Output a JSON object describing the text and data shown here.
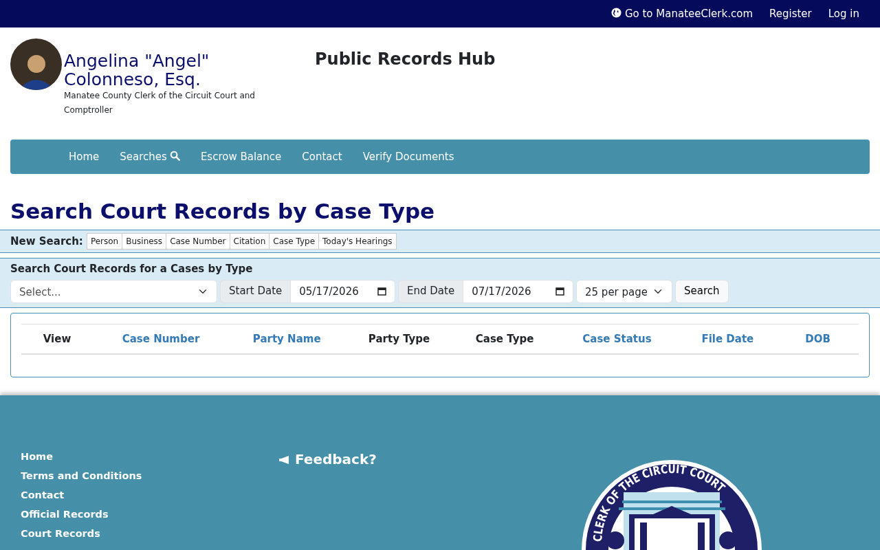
{
  "top_bar": {
    "links": [
      {
        "label": "Go to ManateeClerk.com"
      },
      {
        "label": "Register"
      },
      {
        "label": "Log in"
      }
    ]
  },
  "header": {
    "name_lines": [
      "Angelina \"Angel\"",
      "Colonneso, Esq."
    ],
    "subtitle": "Manatee County Clerk of the Circuit Court and Comptroller",
    "site_title": "Public Records Hub"
  },
  "nav": [
    {
      "label": "Home"
    },
    {
      "label": "Searches"
    },
    {
      "label": "Escrow Balance"
    },
    {
      "label": "Contact"
    },
    {
      "label": "Verify Documents"
    }
  ],
  "page_title": "Search Court Records by Case Type",
  "new_search": {
    "label": "New Search:",
    "options": [
      {
        "label": "Person"
      },
      {
        "label": "Business"
      },
      {
        "label": "Case Number"
      },
      {
        "label": "Citation"
      },
      {
        "label": "Case Type"
      },
      {
        "label": "Today's Hearings"
      }
    ]
  },
  "search_form": {
    "title": "Search Court Records for a Cases by Type",
    "case_type": {
      "value": "Select..."
    },
    "start_date": {
      "label": "Start Date",
      "value": "05/17/2026"
    },
    "end_date": {
      "label": "End Date",
      "value": "07/17/2026"
    },
    "per_page": {
      "value": "25 per page"
    },
    "button": "Search"
  },
  "table": {
    "columns": [
      {
        "label": "View",
        "sortable": false
      },
      {
        "label": "Case Number",
        "sortable": true
      },
      {
        "label": "Party Name",
        "sortable": true
      },
      {
        "label": "Party Type",
        "sortable": false
      },
      {
        "label": "Case Type",
        "sortable": false
      },
      {
        "label": "Case Status",
        "sortable": true
      },
      {
        "label": "File Date",
        "sortable": true
      },
      {
        "label": "DOB",
        "sortable": true
      }
    ]
  },
  "footer": {
    "links": [
      {
        "label": "Home"
      },
      {
        "label": "Terms and Conditions"
      },
      {
        "label": "Contact"
      },
      {
        "label": "Official Records"
      },
      {
        "label": "Court Records"
      }
    ],
    "feedback": "Feedback?",
    "seal_text": "CLERK OF THE CIRCUIT COURT"
  }
}
